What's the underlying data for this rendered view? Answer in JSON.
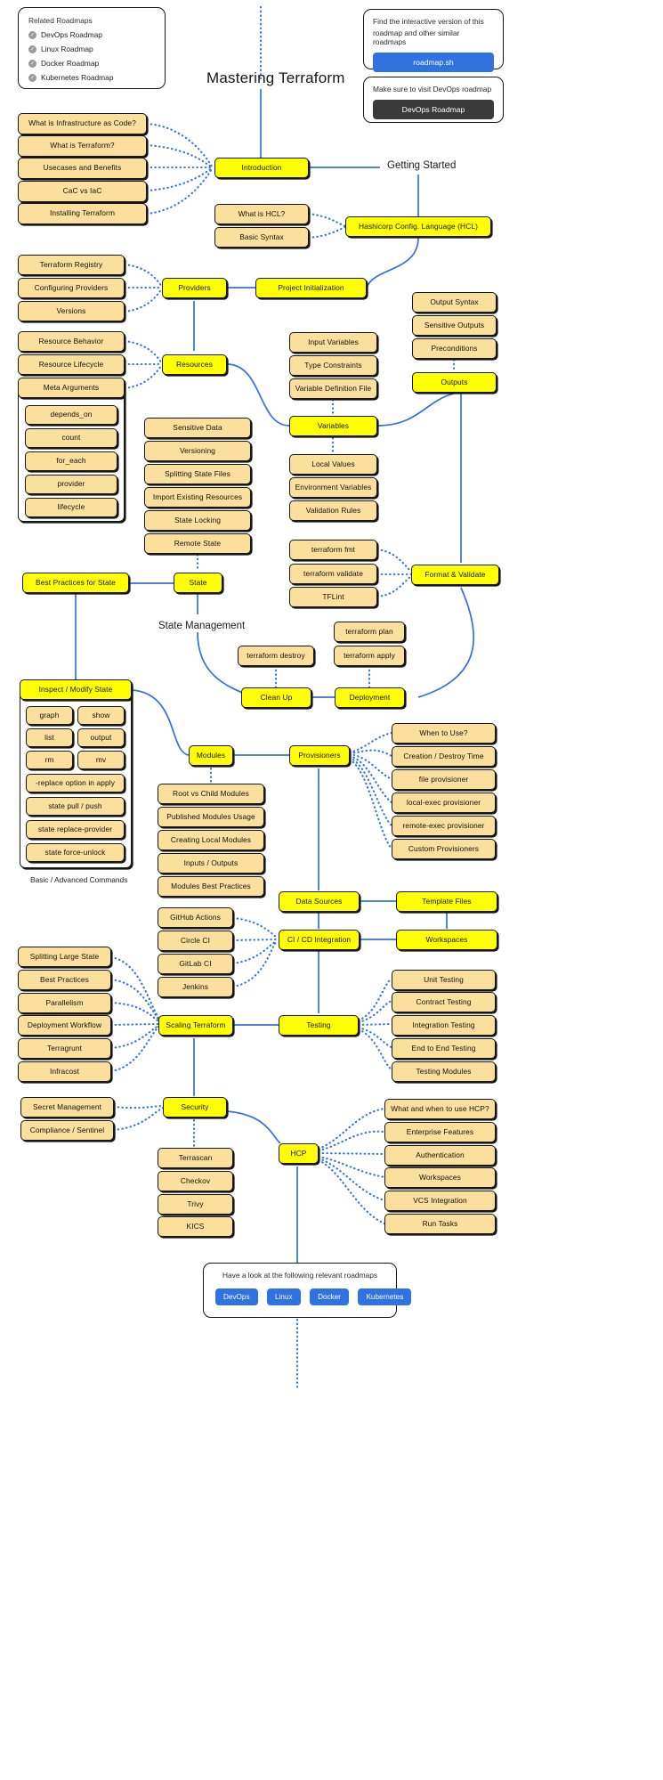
{
  "title": "Mastering Terraform",
  "related_panel": {
    "heading": "Related Roadmaps",
    "items": [
      {
        "label": "DevOps Roadmap",
        "icon": "check-circle-icon"
      },
      {
        "label": "Linux Roadmap",
        "icon": "check-circle-icon"
      },
      {
        "label": "Docker Roadmap",
        "icon": "check-circle-icon"
      },
      {
        "label": "Kubernetes Roadmap",
        "icon": "check-circle-icon"
      }
    ]
  },
  "interactive_panel": {
    "line1": "Find the interactive version of this",
    "line2": "roadmap and other similar roadmaps",
    "button": "roadmap.sh"
  },
  "devops_panel": {
    "text": "Make sure to visit DevOps roadmap",
    "button": "DevOps Roadmap"
  },
  "section_labels": {
    "getting_started": "Getting Started",
    "state_management": "State Management",
    "basic_advanced_commands": "Basic / Advanced Commands"
  },
  "footer_panel": {
    "text": "Have a look at the following relevant roadmaps",
    "pills": [
      "DevOps",
      "Linux",
      "Docker",
      "Kubernetes"
    ]
  },
  "colors": {
    "primary_node": "#ffff00",
    "secondary_node": "#fbdf9d",
    "edge": "#2f72e0",
    "outline": "#161616"
  },
  "nodes": {
    "introduction": "Introduction",
    "what_is_iac": "What is Infrastructure as Code?",
    "what_is_terraform": "What is Terraform?",
    "usecases_benefits": "Usecases and Benefits",
    "cac_vs_iac": "CaC vs IaC",
    "installing_terraform": "Installing Terraform",
    "what_is_hcl": "What is HCL?",
    "basic_syntax": "Basic Syntax",
    "hcl": "Hashicorp Config. Language (HCL)",
    "terraform_registry": "Terraform Registry",
    "configuring_providers": "Configuring Providers",
    "versions": "Versions",
    "providers": "Providers",
    "project_initialization": "Project Initialization",
    "resource_behavior": "Resource Behavior",
    "resource_lifecycle": "Resource Lifecycle",
    "meta_arguments": "Meta Arguments",
    "depends_on": "depends_on",
    "count": "count",
    "for_each": "for_each",
    "provider": "provider",
    "lifecycle": "lifecycle",
    "resources": "Resources",
    "input_variables": "Input Variables",
    "type_constraints": "Type Constraints",
    "variable_definition_file": "Variable Definition File",
    "variables": "Variables",
    "output_syntax": "Output Syntax",
    "sensitive_outputs": "Sensitive Outputs",
    "preconditions": "Preconditions",
    "outputs": "Outputs",
    "local_values": "Local Values",
    "environment_variables": "Environment Variables",
    "validation_rules": "Validation Rules",
    "sensitive_data": "Sensitive Data",
    "versioning": "Versioning",
    "splitting_state_files": "Splitting State Files",
    "import_existing_resources": "Import Existing Resources",
    "state_locking": "State Locking",
    "remote_state": "Remote State",
    "terraform_fmt": "terraform fmt",
    "terraform_validate": "terraform validate",
    "tflint": "TFLint",
    "format_validate": "Format & Validate",
    "best_practices_for_state": "Best Practices for State",
    "state": "State",
    "terraform_plan": "terraform plan",
    "terraform_apply": "terraform apply",
    "terraform_destroy": "terraform destroy",
    "clean_up": "Clean Up",
    "deployment": "Deployment",
    "inspect_modify_state": "Inspect / Modify State",
    "graph": "graph",
    "show": "show",
    "list": "list",
    "output": "output",
    "rm": "rm",
    "mv": "mv",
    "replace_option": "-replace option in apply",
    "state_pull_push": "state pull / push",
    "state_replace_provider": "state replace-provider",
    "state_force_unlock": "state force-unlock",
    "modules": "Modules",
    "provisioners": "Provisioners",
    "when_to_use": "When to Use?",
    "creation_destroy_time": "Creation / Destroy Time",
    "file_provisioner": "file provisioner",
    "local_exec_provisioner": "local-exec provisioner",
    "remote_exec_provisioner": "remote-exec provisioner",
    "custom_provisioners": "Custom Provisioners",
    "root_vs_child_modules": "Root vs Child Modules",
    "published_modules_usage": "Published Modules Usage",
    "creating_local_modules": "Creating Local Modules",
    "inputs_outputs": "Inputs / Outputs",
    "modules_best_practices": "Modules Best Practices",
    "data_sources": "Data Sources",
    "template_files": "Template Files",
    "github_actions": "GitHub Actions",
    "circle_ci": "Circle CI",
    "gitlab_ci": "GitLab CI",
    "jenkins": "Jenkins",
    "ci_cd_integration": "CI / CD Integration",
    "workspaces": "Workspaces",
    "unit_testing": "Unit Testing",
    "contract_testing": "Contract Testing",
    "integration_testing": "Integration Testing",
    "end_to_end_testing": "End to End Testing",
    "testing_modules": "Testing Modules",
    "splitting_large_state": "Splitting Large State",
    "best_practices": "Best Practices",
    "parallelism": "Parallelism",
    "deployment_workflow": "Deployment Workflow",
    "terragrunt": "Terragrunt",
    "infracost": "Infracost",
    "scaling_terraform": "Scaling Terraform",
    "testing": "Testing",
    "secret_management": "Secret Management",
    "compliance_sentinel": "Compliance / Sentinel",
    "security": "Security",
    "terrascan": "Terrascan",
    "checkov": "Checkov",
    "trivy": "Trivy",
    "kics": "KICS",
    "hcp": "HCP",
    "what_and_when_hcp": "What and when to use HCP?",
    "enterprise_features": "Enterprise Features",
    "authentication": "Authentication",
    "hcp_workspaces": "Workspaces",
    "vcs_integration": "VCS Integration",
    "run_tasks": "Run Tasks"
  }
}
